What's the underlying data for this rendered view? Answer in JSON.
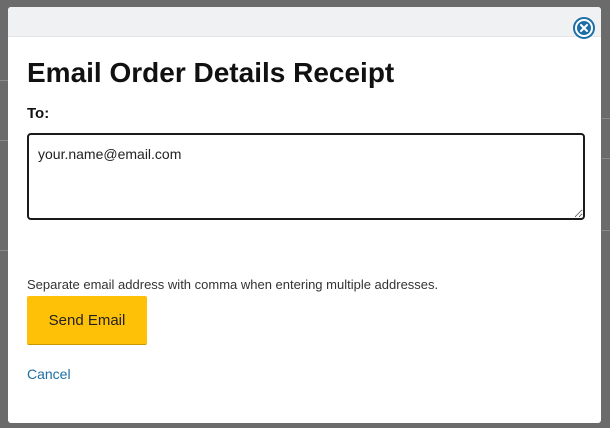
{
  "modal": {
    "title": "Email Order Details Receipt",
    "to_label": "To:",
    "email_value": "your.name@email.com",
    "hint": "Separate email address with comma when entering multiple addresses.",
    "send_label": "Send Email",
    "cancel_label": "Cancel",
    "close_icon": "close-circle-icon"
  },
  "colors": {
    "accent": "#ffc107",
    "link": "#1d6fa5"
  }
}
